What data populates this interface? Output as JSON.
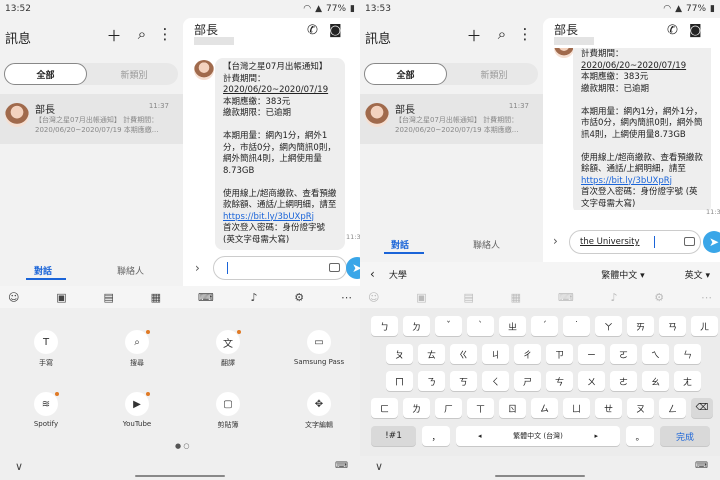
{
  "left": {
    "time": "13:52",
    "battery": "77%",
    "title": "訊息",
    "filters": {
      "all": "全部",
      "category": "新類別"
    },
    "conv": {
      "name": "部長",
      "time": "11:37",
      "preview": "【台灣之星07月出帳通知】 計費期間：2020/06/20~2020/07/19 本期應繳..."
    },
    "tabs": {
      "conversations": "對話",
      "contacts": "聯絡人"
    },
    "chat": {
      "name": "部長",
      "time": "11:37"
    },
    "panel": [
      {
        "icon": "handwriting-icon",
        "label": "手寫"
      },
      {
        "icon": "search-icon",
        "label": "搜尋"
      },
      {
        "icon": "translate-icon",
        "label": "翻譯"
      },
      {
        "icon": "samsung-pass-icon",
        "label": "Samsung Pass"
      },
      {
        "icon": "spotify-icon",
        "label": "Spotify"
      },
      {
        "icon": "youtube-icon",
        "label": "YouTube"
      },
      {
        "icon": "clipboard-icon",
        "label": "剪貼簿"
      },
      {
        "icon": "text-editing-icon",
        "label": "文字編輯"
      }
    ]
  },
  "right": {
    "time": "13:53",
    "battery": "77%",
    "title": "訊息",
    "filters": {
      "all": "全部",
      "category": "新類別"
    },
    "conv": {
      "name": "部長",
      "time": "11:37",
      "preview": "【台灣之星07月出帳通知】 計費期間：2020/06/20~2020/07/19 本期應繳..."
    },
    "tabs": {
      "conversations": "對話",
      "contacts": "聯絡人"
    },
    "chat": {
      "name": "部長",
      "time": "11:37",
      "input": "the University"
    },
    "suggestion": "大學",
    "lang_select": "繁體中文",
    "lang_mode": "英文",
    "keys": {
      "row1": [
        "ㄅ",
        "ㄉ",
        "ˇ",
        "ˋ",
        "ㄓ",
        "ˊ",
        "˙",
        "ㄚ",
        "ㄞ",
        "ㄢ",
        "ㄦ"
      ],
      "row2": [
        "ㄆ",
        "ㄊ",
        "ㄍ",
        "ㄐ",
        "ㄔ",
        "ㄗ",
        "ㄧ",
        "ㄛ",
        "ㄟ",
        "ㄣ"
      ],
      "row3": [
        "ㄇ",
        "ㄋ",
        "ㄎ",
        "ㄑ",
        "ㄕ",
        "ㄘ",
        "ㄨ",
        "ㄜ",
        "ㄠ",
        "ㄤ"
      ],
      "row4": [
        "ㄈ",
        "ㄌ",
        "ㄏ",
        "ㄒ",
        "ㄖ",
        "ㄙ",
        "ㄩ",
        "ㄝ",
        "ㄡ",
        "ㄥ"
      ],
      "sym": "!#1",
      "comma": "，",
      "space": "繁體中文 (台灣)",
      "period": "。",
      "done": "完成"
    }
  },
  "message": {
    "title": "【台灣之星07月出帳通知】",
    "period_label": "計費期間：",
    "period": "2020/06/20~2020/07/19",
    "due": "本期應繳：383元",
    "overdue": "繳款期限：已逾期",
    "usage": "本期用量：網內1分，網外1分，市話0分，網內簡訊0則，網外簡訊4則，上網使用量8.73GB",
    "online": "使用線上/超商繳款、查看預繳款餘額、通話/上網明細，請至",
    "url": "https://bit.ly/3bUXpRj",
    "login": "首次登入密碼：身份證字號 (英文字母需大寫)"
  }
}
